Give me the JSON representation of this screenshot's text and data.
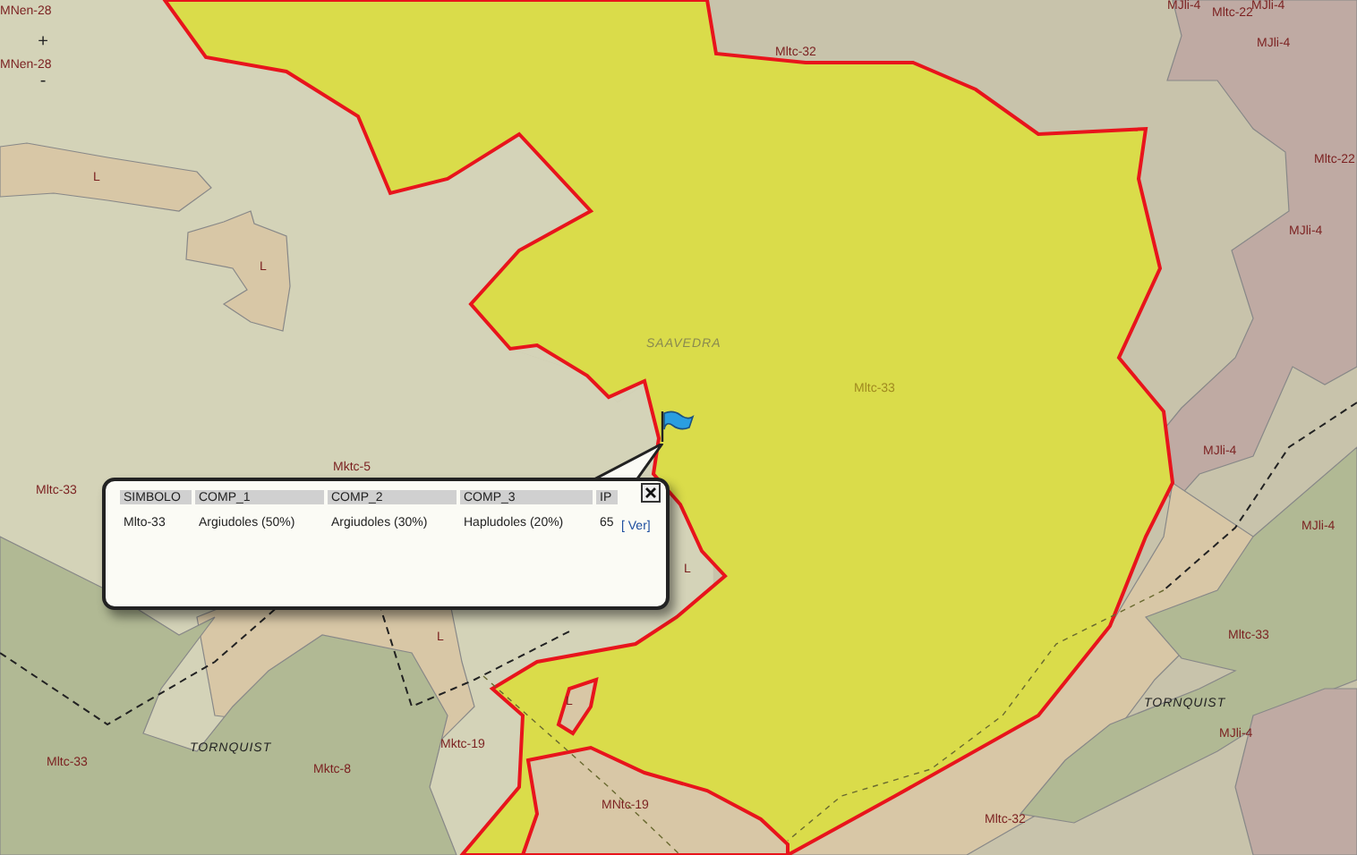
{
  "map": {
    "zoom_controls": [
      {
        "label": "+"
      },
      {
        "label": "-"
      }
    ],
    "labels": [
      {
        "text": "MNen-28",
        "kind": "unit"
      },
      {
        "text": "MNen-28",
        "kind": "unit"
      },
      {
        "text": "L",
        "kind": "unit"
      },
      {
        "text": "L",
        "kind": "unit"
      },
      {
        "text": "SAAVEDRA",
        "kind": "town"
      },
      {
        "text": "Mltc-33",
        "kind": "highlight"
      },
      {
        "text": "Mltc-32",
        "kind": "unit"
      },
      {
        "text": "MJli-4",
        "kind": "unit"
      },
      {
        "text": "Mltc-22",
        "kind": "unit"
      },
      {
        "text": "MJli-4",
        "kind": "unit"
      },
      {
        "text": "MJli-4",
        "kind": "unit"
      },
      {
        "text": "Mltc-22",
        "kind": "unit"
      },
      {
        "text": "MJli-4",
        "kind": "unit"
      },
      {
        "text": "Mltc-33",
        "kind": "unit"
      },
      {
        "text": "Mktc-5",
        "kind": "unit"
      },
      {
        "text": "L",
        "kind": "unit"
      },
      {
        "text": "L",
        "kind": "unit"
      },
      {
        "text": "MJli-4",
        "kind": "unit"
      },
      {
        "text": "MJli-4",
        "kind": "unit"
      },
      {
        "text": "Mltc-33",
        "kind": "unit"
      },
      {
        "text": "TORNQUIST",
        "kind": "place"
      },
      {
        "text": "MJli-4",
        "kind": "unit"
      },
      {
        "text": "Mltc-32",
        "kind": "unit"
      },
      {
        "text": "Mltc-33",
        "kind": "unit"
      },
      {
        "text": "TORNQUIST",
        "kind": "place"
      },
      {
        "text": "Mktc-8",
        "kind": "unit"
      },
      {
        "text": "Mktc-19",
        "kind": "unit"
      },
      {
        "text": "L",
        "kind": "unit"
      },
      {
        "text": "MNtc-19",
        "kind": "unit"
      }
    ]
  },
  "popup": {
    "columns": [
      "SIMBOLO",
      "COMP_1",
      "COMP_2",
      "COMP_3",
      "IP"
    ],
    "rows": [
      {
        "cells": [
          "Mlto-33",
          "Argiudoles (50%)",
          "Argiudoles (30%)",
          "Hapludoles (20%)",
          "65"
        ],
        "link": "[ Ver]"
      }
    ]
  }
}
